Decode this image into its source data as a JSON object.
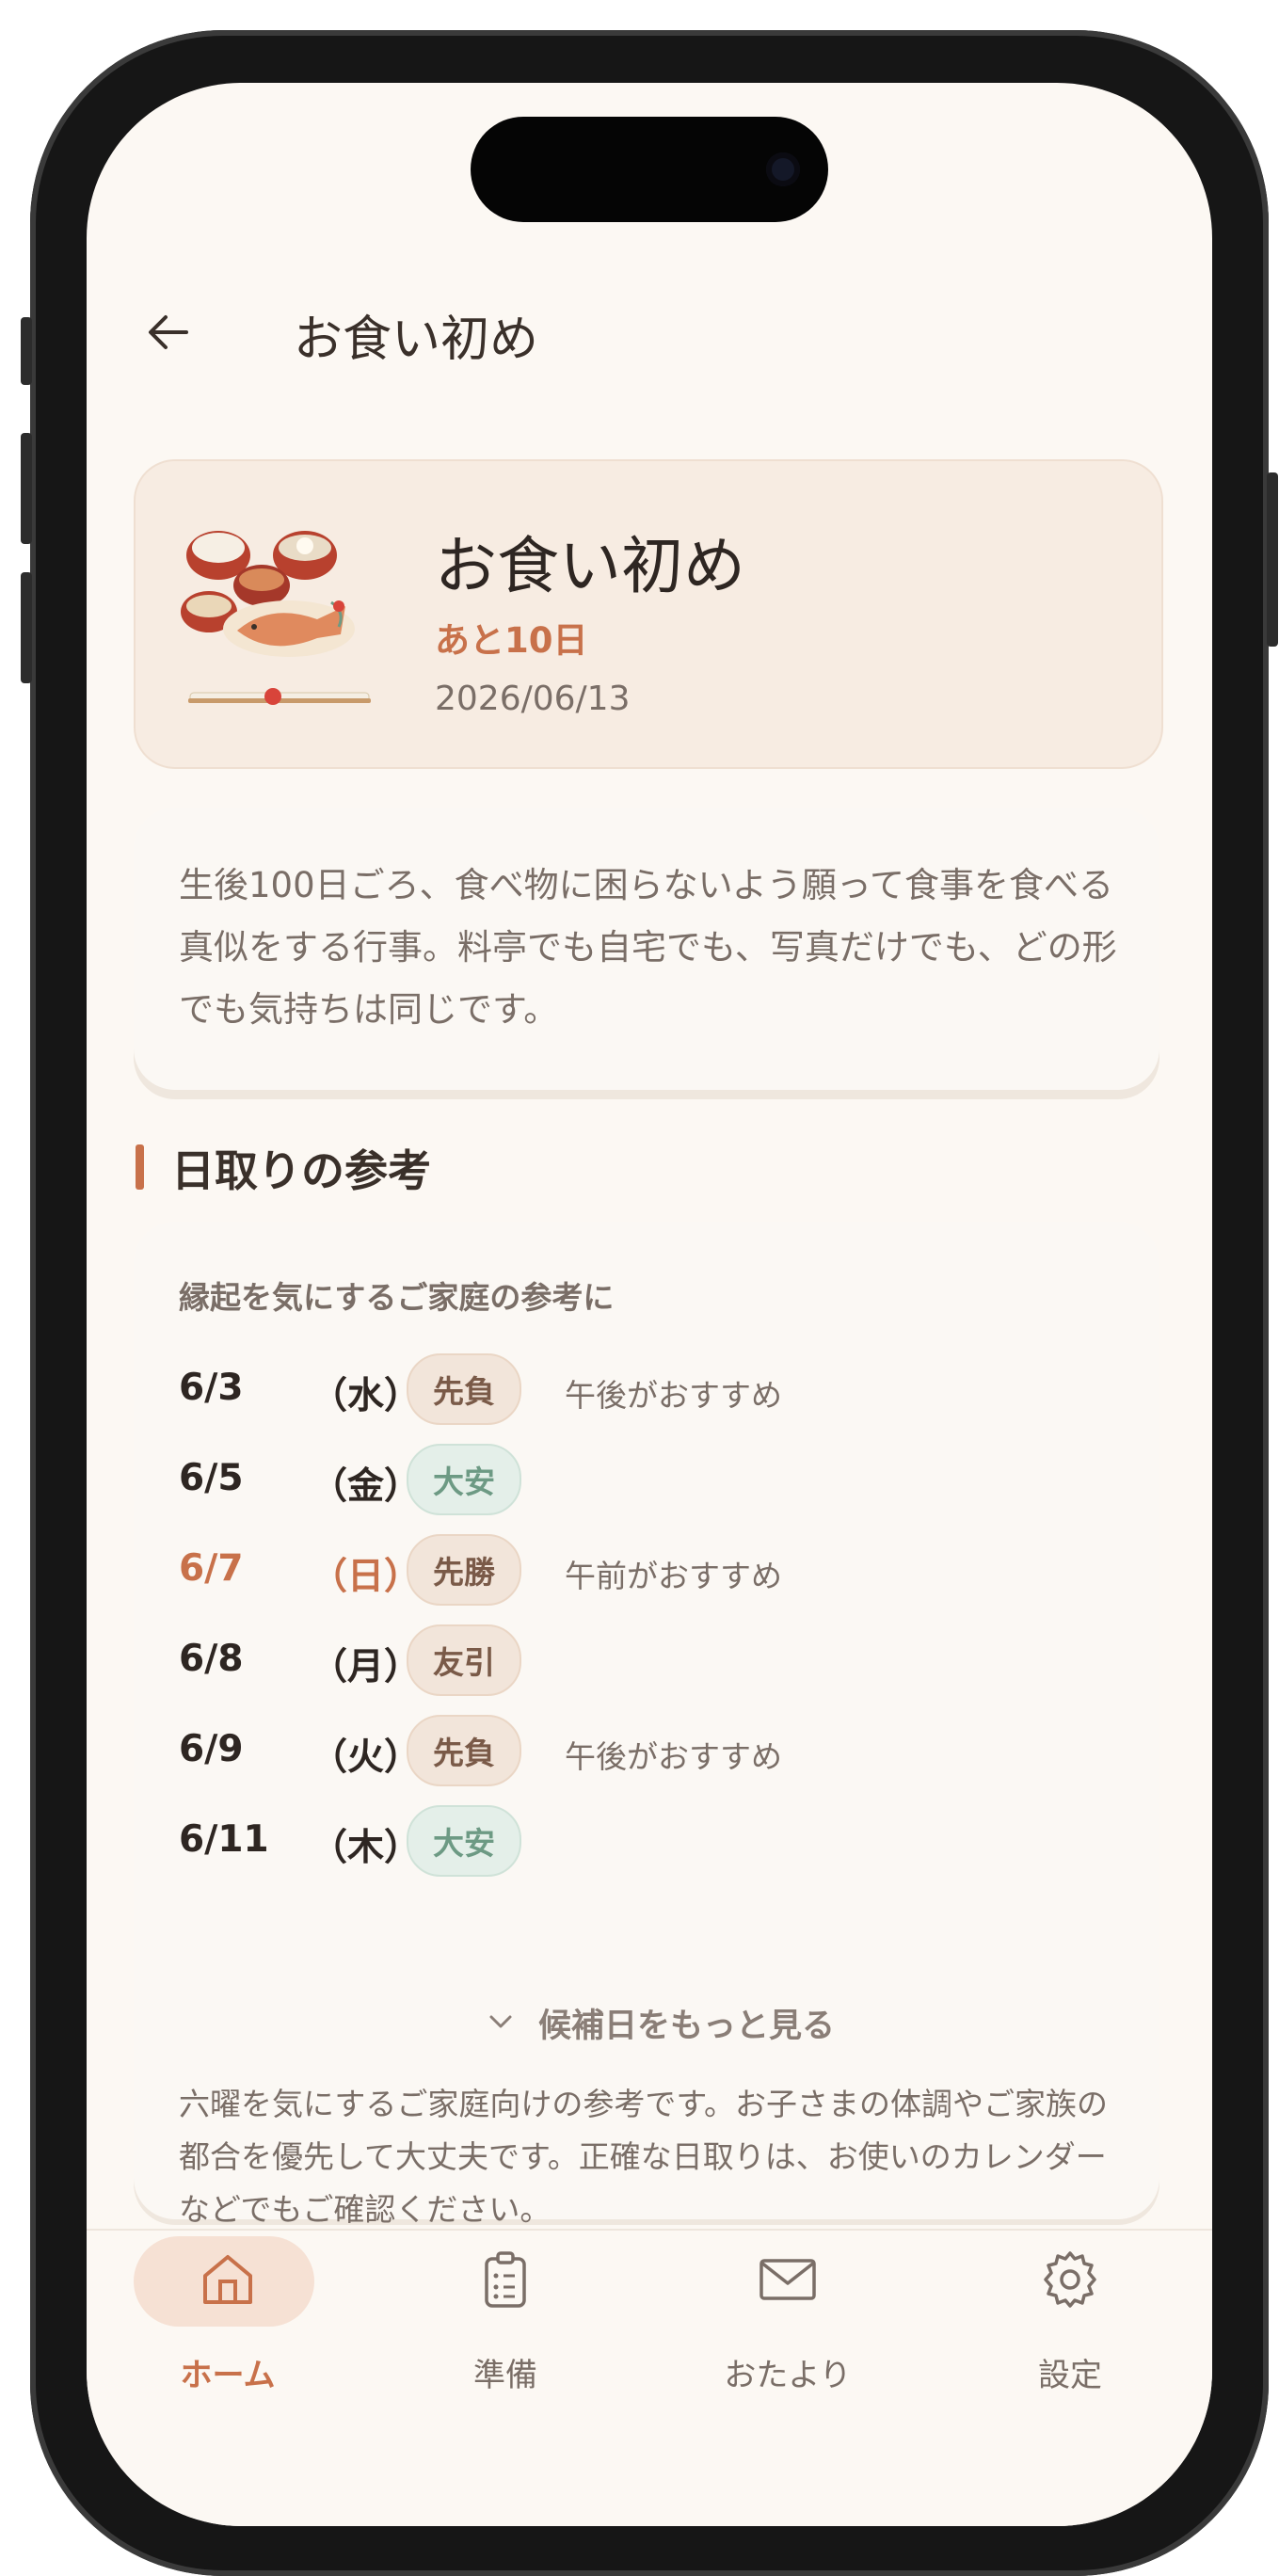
{
  "header": {
    "title": "お食い初め"
  },
  "hero": {
    "title": "お食い初め",
    "countdown": "あと10日",
    "date": "2026/06/13",
    "image": "okuizome-meal-illustration"
  },
  "description": "生後100日ごろ、食べ物に困らないよう願って食事を食べる真似をする行事。料亭でも自宅でも、写真だけでも、どの形でも気持ちは同じです。",
  "section": {
    "title": "日取りの参考"
  },
  "card": {
    "subtitle": "縁起を気にするご家庭の参考に",
    "dates": [
      {
        "date": "6/3",
        "dow": "（水）",
        "rokuyo": "先負",
        "note": "午後がおすすめ",
        "tone": "warm",
        "highlight": false
      },
      {
        "date": "6/5",
        "dow": "（金）",
        "rokuyo": "大安",
        "note": "",
        "tone": "green",
        "highlight": false
      },
      {
        "date": "6/7",
        "dow": "（日）",
        "rokuyo": "先勝",
        "note": "午前がおすすめ",
        "tone": "warm",
        "highlight": true
      },
      {
        "date": "6/8",
        "dow": "（月）",
        "rokuyo": "友引",
        "note": "",
        "tone": "warm",
        "highlight": false
      },
      {
        "date": "6/9",
        "dow": "（火）",
        "rokuyo": "先負",
        "note": "午後がおすすめ",
        "tone": "warm",
        "highlight": false
      },
      {
        "date": "6/11",
        "dow": "（木）",
        "rokuyo": "大安",
        "note": "",
        "tone": "green",
        "highlight": false
      }
    ],
    "more_label": "候補日をもっと見る",
    "footnote": "六曜を気にするご家庭向けの参考です。お子さまの体調やご家族の都合を優先して大丈夫です。正確な日取りは、お使いのカレンダーなどでもご確認ください。"
  },
  "tabs": [
    {
      "label": "ホーム",
      "icon": "home-icon",
      "active": true
    },
    {
      "label": "準備",
      "icon": "clipboard-icon",
      "active": false
    },
    {
      "label": "おたより",
      "icon": "mail-icon",
      "active": false
    },
    {
      "label": "設定",
      "icon": "gear-icon",
      "active": false
    }
  ],
  "colors": {
    "accent": "#c8714a",
    "background": "#fcf8f3",
    "green": "#6d9a84"
  }
}
